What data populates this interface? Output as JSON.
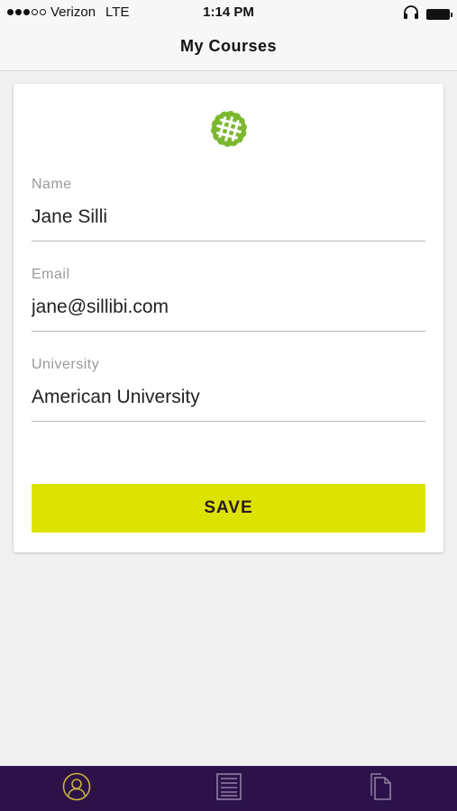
{
  "status_bar": {
    "carrier": "Verizon",
    "network": "LTE",
    "time": "1:14 PM",
    "signal_bars_filled": 3,
    "signal_bars_total": 5
  },
  "nav": {
    "title": "My Courses"
  },
  "form": {
    "name": {
      "label": "Name",
      "value": "Jane Silli"
    },
    "email": {
      "label": "Email",
      "value": "jane@sillibi.com"
    },
    "university": {
      "label": "University",
      "value": "American University"
    }
  },
  "save_button": {
    "label": "SAVE"
  },
  "tab_bar": {
    "items": [
      {
        "icon": "profile-icon",
        "active": true
      },
      {
        "icon": "courses-list-icon",
        "active": false
      },
      {
        "icon": "documents-icon",
        "active": false
      }
    ]
  },
  "colors": {
    "accent": "#dde300",
    "tab_bar_bg": "#2d124a",
    "active_tab_icon": "#c8b23a",
    "inactive_tab_icon": "#8e7fa3",
    "logo_green": "#7cb82f"
  }
}
